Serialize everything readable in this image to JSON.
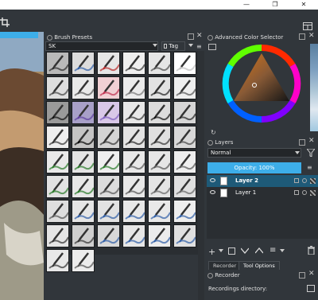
{
  "window": {
    "close_glyph": "✕",
    "maximize_glyph": "❐",
    "minimize_glyph": "—"
  },
  "brush_presets": {
    "title": "Brush Presets",
    "filter_value": "SK",
    "tag_label": "Tag",
    "presets": [
      {
        "color": "#b9b9b9",
        "stroke": "#2c2c2c"
      },
      {
        "color": "#dcdcdc",
        "stroke": "#2f5ea6"
      },
      {
        "color": "#e6e6e6",
        "stroke": "#b82a2a"
      },
      {
        "color": "#efefef",
        "stroke": "#333"
      },
      {
        "color": "#e5e5e5",
        "stroke": "#4d4d4d"
      },
      {
        "color": "#ffffff",
        "stroke": "#c0c0c0"
      },
      {
        "color": "#dedede",
        "stroke": "#444"
      },
      {
        "color": "#e9e9e9",
        "stroke": "#555"
      },
      {
        "color": "#f1d0d4",
        "stroke": "#c03050"
      },
      {
        "color": "#ebebeb",
        "stroke": "#777"
      },
      {
        "color": "#e2e2e2",
        "stroke": "#222"
      },
      {
        "color": "#eeeeee",
        "stroke": "#555"
      },
      {
        "color": "#9a9a9a",
        "stroke": "#111"
      },
      {
        "color": "#a8a0c8",
        "stroke": "#6040a0"
      },
      {
        "color": "#d9c8e8",
        "stroke": "#8060c0"
      },
      {
        "color": "#e8e8e8",
        "stroke": "#333"
      },
      {
        "color": "#dcdcdc",
        "stroke": "#111"
      },
      {
        "color": "#d6d6d6",
        "stroke": "#222"
      },
      {
        "color": "#eeeeee",
        "stroke": "#333"
      },
      {
        "color": "#c4c4c4",
        "stroke": "#000"
      },
      {
        "color": "#d4d4d4",
        "stroke": "#333"
      },
      {
        "color": "#e3e3e3",
        "stroke": "#222"
      },
      {
        "color": "#e0e0e0",
        "stroke": "#333"
      },
      {
        "color": "#d8d8d8",
        "stroke": "#444"
      },
      {
        "color": "#e9e9e9",
        "stroke": "#2a7a2a"
      },
      {
        "color": "#e4e4e4",
        "stroke": "#2a7a2a"
      },
      {
        "color": "#eeeeee",
        "stroke": "#2a7a2a"
      },
      {
        "color": "#e8e8e8",
        "stroke": "#555"
      },
      {
        "color": "#e6e6e6",
        "stroke": "#555"
      },
      {
        "color": "#eeeeee",
        "stroke": "#555"
      },
      {
        "color": "#e2e2e2",
        "stroke": "#2a7a2a"
      },
      {
        "color": "#e7e7e7",
        "stroke": "#2a7a2a"
      },
      {
        "color": "#dcdcdc",
        "stroke": "#555"
      },
      {
        "color": "#e8e8e8",
        "stroke": "#555"
      },
      {
        "color": "#e4e4e4",
        "stroke": "#666"
      },
      {
        "color": "#e0e0e0",
        "stroke": "#666"
      },
      {
        "color": "#dedede",
        "stroke": "#555"
      },
      {
        "color": "#e5e5e5",
        "stroke": "#2f5ea6"
      },
      {
        "color": "#e2e2e2",
        "stroke": "#2f5ea6"
      },
      {
        "color": "#e8e8e8",
        "stroke": "#2f5ea6"
      },
      {
        "color": "#e9e9e9",
        "stroke": "#2f5ea6"
      },
      {
        "color": "#eeeeee",
        "stroke": "#2f5ea6"
      },
      {
        "color": "#e5e5e5",
        "stroke": "#333"
      },
      {
        "color": "#cfcfcf",
        "stroke": "#333"
      },
      {
        "color": "#d8d8d8",
        "stroke": "#2f5ea6"
      },
      {
        "color": "#e6e6e6",
        "stroke": "#2f5ea6"
      },
      {
        "color": "#ececec",
        "stroke": "#2f5ea6"
      },
      {
        "color": "#e0e0e0",
        "stroke": "#2f5ea6"
      },
      {
        "color": "#e8e8e8",
        "stroke": "#333"
      },
      {
        "color": "#ececec",
        "stroke": "#555"
      }
    ]
  },
  "color_selector": {
    "title": "Advanced Color Selector"
  },
  "layers": {
    "title": "Layers",
    "blend_mode": "Normal",
    "opacity_label": "Opacity:  100%",
    "items": [
      {
        "name": "Layer 2",
        "selected": true
      },
      {
        "name": "Layer 1",
        "selected": false
      }
    ]
  },
  "bottom_tabs": {
    "recorder": "Recorder",
    "tool_options": "Tool Options"
  },
  "recorder": {
    "title": "Recorder",
    "directory_label": "Recordings directory:"
  },
  "colors": {
    "accent": "#3daee9",
    "panel_bg": "#31363b",
    "dark_bg": "#2a2e32"
  }
}
